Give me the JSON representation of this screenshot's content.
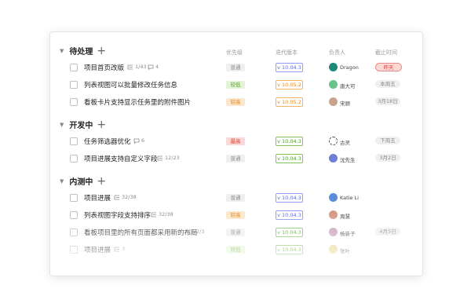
{
  "headers": {
    "priority": "优先级",
    "version": "迭代版本",
    "owner": "负责人",
    "deadline": "截止时间"
  },
  "groups": [
    {
      "title": "待处理",
      "tasks": [
        {
          "title": "项目首页改版",
          "subtasks": "1/43",
          "comments": "4",
          "priority": "普通",
          "version": "v 10.04.3",
          "owner": "Dragon",
          "deadline": "昨天"
        },
        {
          "title": "列表视图可以批量修改任务信息",
          "priority": "较低",
          "version": "v 10.05.2",
          "owner": "唐大可",
          "deadline": "本周五"
        },
        {
          "title": "看板卡片支持显示任务里的附件图片",
          "priority": "较高",
          "version": "v 10.05.2",
          "owner": "宋顾",
          "deadline": "3月18日"
        }
      ]
    },
    {
      "title": "开发中",
      "tasks": [
        {
          "title": "任务筛选器优化",
          "comments": "6",
          "priority": "最高",
          "version": "v 10.04.3",
          "owner": "古灵",
          "deadline": "下周五"
        },
        {
          "title": "项目进展支持自定义字段",
          "subtasks": "12/23",
          "priority": "普通",
          "version": "v 10.04.3",
          "owner": "沈先生",
          "deadline": "3月2日"
        }
      ]
    },
    {
      "title": "内测中",
      "tasks": [
        {
          "title": "项目进展",
          "subtasks": "32/38",
          "priority": "普通",
          "version": "v 10.04.3",
          "owner": "Katie Li"
        },
        {
          "title": "列表视图字段支持排序",
          "subtasks": "32/38",
          "priority": "较高",
          "version": "v 10.04.3",
          "owner": "周慧"
        },
        {
          "title": "看板项目里的所有页面都采用新的布局",
          "subtasks": "2/3",
          "priority": "普通",
          "version": "v 10.04.3",
          "owner": "杨新子",
          "deadline": "4月5日"
        },
        {
          "title": "项目进展",
          "subtasks": "3",
          "priority": "较低",
          "version": "v 10.04.3",
          "owner": "张叶"
        }
      ]
    }
  ],
  "colors": {
    "overdue": "#e1433a",
    "version_blue": "#5a69d8",
    "version_orange": "#e08a22",
    "version_green": "#4e9e2a"
  }
}
